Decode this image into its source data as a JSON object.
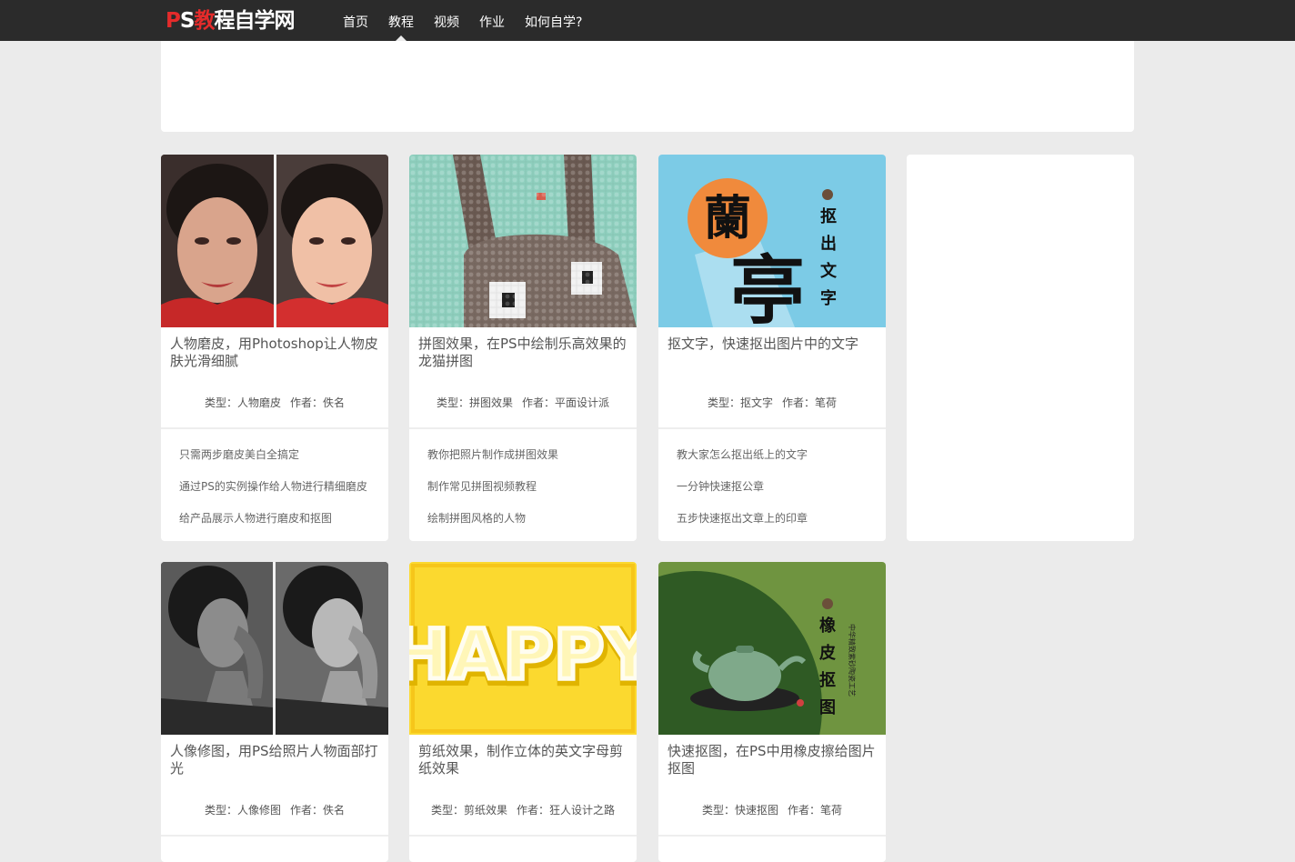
{
  "header": {
    "logo": {
      "p": "P",
      "s": "S",
      "j": "教",
      "rest": "程自学网"
    },
    "nav": [
      {
        "label": "首页"
      },
      {
        "label": "教程",
        "active": true
      },
      {
        "label": "视频"
      },
      {
        "label": "作业"
      },
      {
        "label": "如何自学?"
      }
    ]
  },
  "meta_labels": {
    "type": "类型：",
    "author": "作者："
  },
  "cards": [
    {
      "title": "人物磨皮，用Photoshop让人物皮肤光滑细腻",
      "type": "人物磨皮",
      "author": "佚名",
      "image": "portrait-retouch-before-after",
      "related": [
        "只需两步磨皮美白全搞定",
        "通过PS的实例操作给人物进行精细磨皮",
        "给产品展示人物进行磨皮和抠图"
      ]
    },
    {
      "title": "拼图效果，在PS中绘制乐高效果的龙猫拼图",
      "type": "拼图效果",
      "author": "平面设计派",
      "image": "pixel-rabbit-mosaic",
      "related": [
        "教你把照片制作成拼图效果",
        "制作常见拼图视频教程",
        "绘制拼图风格的人物"
      ]
    },
    {
      "title": "抠文字，快速抠出图片中的文字",
      "type": "抠文字",
      "author": "笔荷",
      "image": "calligraphy-lan-ting",
      "image_text": {
        "big1": "蘭",
        "big2": "亭",
        "side": [
          "抠",
          "出",
          "文",
          "字"
        ]
      },
      "related": [
        "教大家怎么抠出纸上的文字",
        "一分钟快速抠公章",
        "五步快速抠出文章上的印章"
      ]
    },
    {
      "title": "人像修图，用PS给照片人物面部打光",
      "type": "人像修图",
      "author": "佚名",
      "image": "bw-portrait-lighting"
    },
    {
      "title": "剪纸效果，制作立体的英文字母剪纸效果",
      "type": "剪纸效果",
      "author": "狂人设计之路",
      "image": "happy-papercut",
      "image_text": {
        "word": "HAPPY"
      }
    },
    {
      "title": "快速抠图，在PS中用橡皮擦给图片抠图",
      "type": "快速抠图",
      "author": "笔荷",
      "image": "teapot-eraser",
      "image_text": {
        "side": [
          "橡",
          "皮",
          "抠",
          "图"
        ],
        "small": "中华精致紫砂陶瓷工艺"
      }
    }
  ]
}
